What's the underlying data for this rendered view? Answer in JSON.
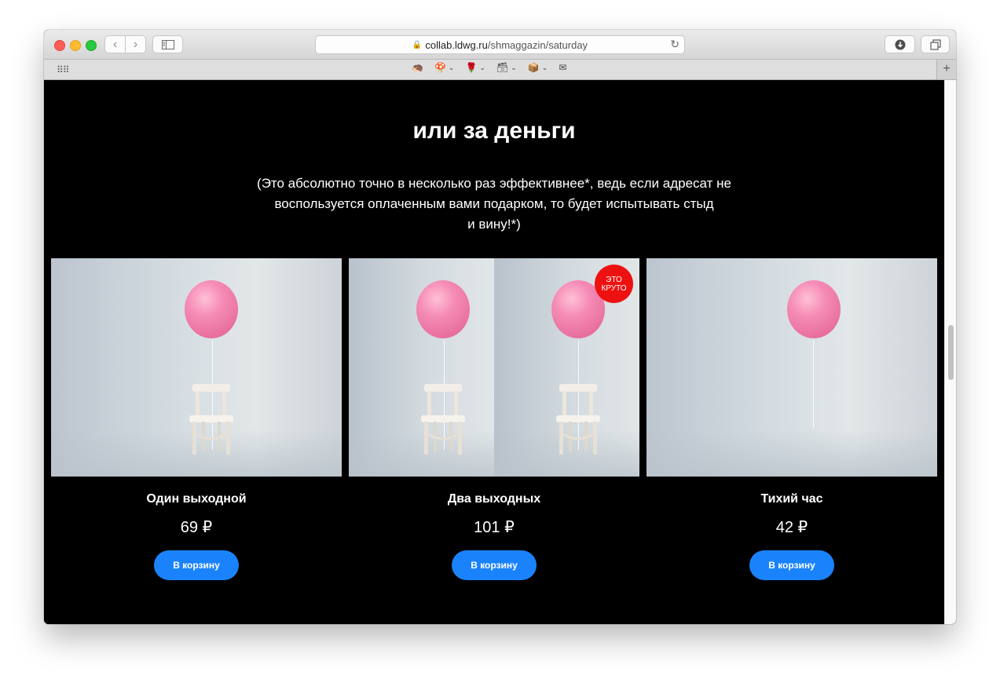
{
  "browser": {
    "url_host": "collab.ldwg.ru",
    "url_path": "/shmaggazin/saturday",
    "favorites": [
      {
        "icon": "🦔",
        "has_menu": false
      },
      {
        "icon": "🍄",
        "has_menu": true
      },
      {
        "icon": "🌹",
        "has_menu": true
      },
      {
        "icon": "🗃",
        "has_menu": true
      },
      {
        "icon": "📦",
        "has_menu": true
      },
      {
        "icon": "✉",
        "has_menu": false
      }
    ]
  },
  "section": {
    "title": "или за деньги",
    "subtitle_line1": "(Это абсолютно точно в несколько раз эффективнее*, ведь если адресат не",
    "subtitle_line2": "воспользуется оплаченным вами подарком, то будет испытывать стыд",
    "subtitle_line3": "и вину!*)"
  },
  "products": [
    {
      "name": "Один выходной",
      "price": "69 ₽",
      "button": "В корзину"
    },
    {
      "name": "Два выходных",
      "price": "101 ₽",
      "button": "В корзину",
      "badge_line1": "ЭТО",
      "badge_line2": "КРУТО"
    },
    {
      "name": "Тихий час",
      "price": "42 ₽",
      "button": "В корзину"
    }
  ],
  "colors": {
    "page_background": "#000000",
    "button": "#1a83fb",
    "badge": "#ee1111",
    "balloon": "#f58bb5"
  }
}
